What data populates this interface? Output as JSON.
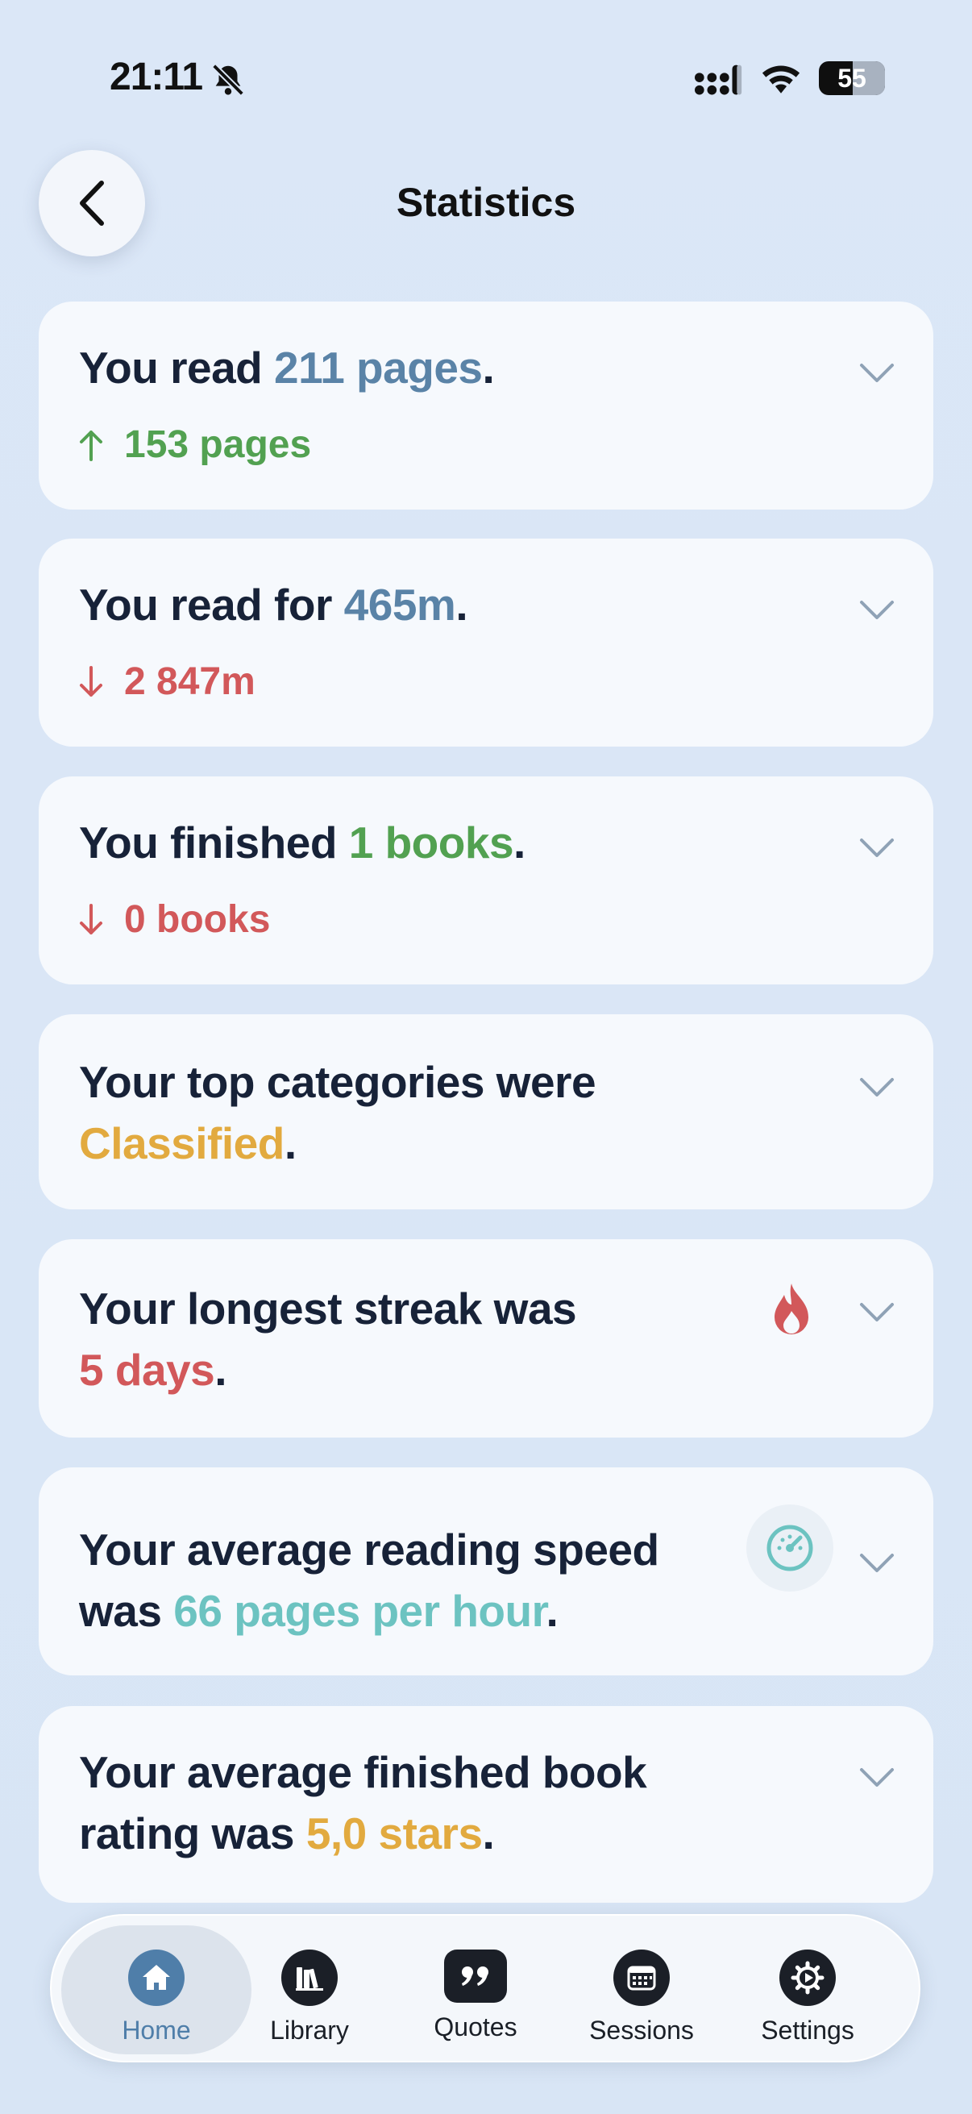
{
  "status_bar": {
    "time": "21:11",
    "battery": "55",
    "icons": [
      "bell-slash-icon",
      "signal-icon",
      "wifi-icon",
      "battery-icon"
    ]
  },
  "header": {
    "title": "Statistics",
    "back_icon": "chevron-left-icon"
  },
  "colors": {
    "background": "#d9e6f6",
    "card": "#f6f9fd",
    "text": "#172238",
    "blue": "#5a83a7",
    "green": "#52a151",
    "red": "#d2585a",
    "orange": "#e2aa3f",
    "teal": "#6cc3c1"
  },
  "cards": {
    "pages": {
      "prefix": "You read ",
      "value": "211 pages",
      "suffix": ".",
      "change": "153 pages",
      "change_direction": "up"
    },
    "time": {
      "prefix": "You read for ",
      "value": "465m",
      "suffix": ".",
      "change": "2 847m",
      "change_direction": "down"
    },
    "books": {
      "prefix": "You finished ",
      "value": "1 books",
      "suffix": ".",
      "change": "0 books",
      "change_direction": "down"
    },
    "categories": {
      "line1": "Your top categories were",
      "value": "Classified",
      "suffix": "."
    },
    "streak": {
      "line1": "Your longest streak was",
      "value": "5 days",
      "suffix": ".",
      "icon": "flame-icon"
    },
    "speed": {
      "line1": "Your average reading speed",
      "prefix": "was ",
      "value": "66 pages per hour",
      "suffix": ".",
      "icon": "speedometer-icon"
    },
    "rating": {
      "line1": "Your average finished book",
      "prefix": "rating was ",
      "value": "5,0 stars",
      "suffix": "."
    }
  },
  "tabbar": {
    "items": [
      {
        "label": "Home",
        "icon": "home-icon",
        "active": true
      },
      {
        "label": "Library",
        "icon": "books-icon",
        "active": false
      },
      {
        "label": "Quotes",
        "icon": "quote-icon",
        "active": false
      },
      {
        "label": "Sessions",
        "icon": "calendar-icon",
        "active": false
      },
      {
        "label": "Settings",
        "icon": "gear-icon",
        "active": false
      }
    ]
  }
}
